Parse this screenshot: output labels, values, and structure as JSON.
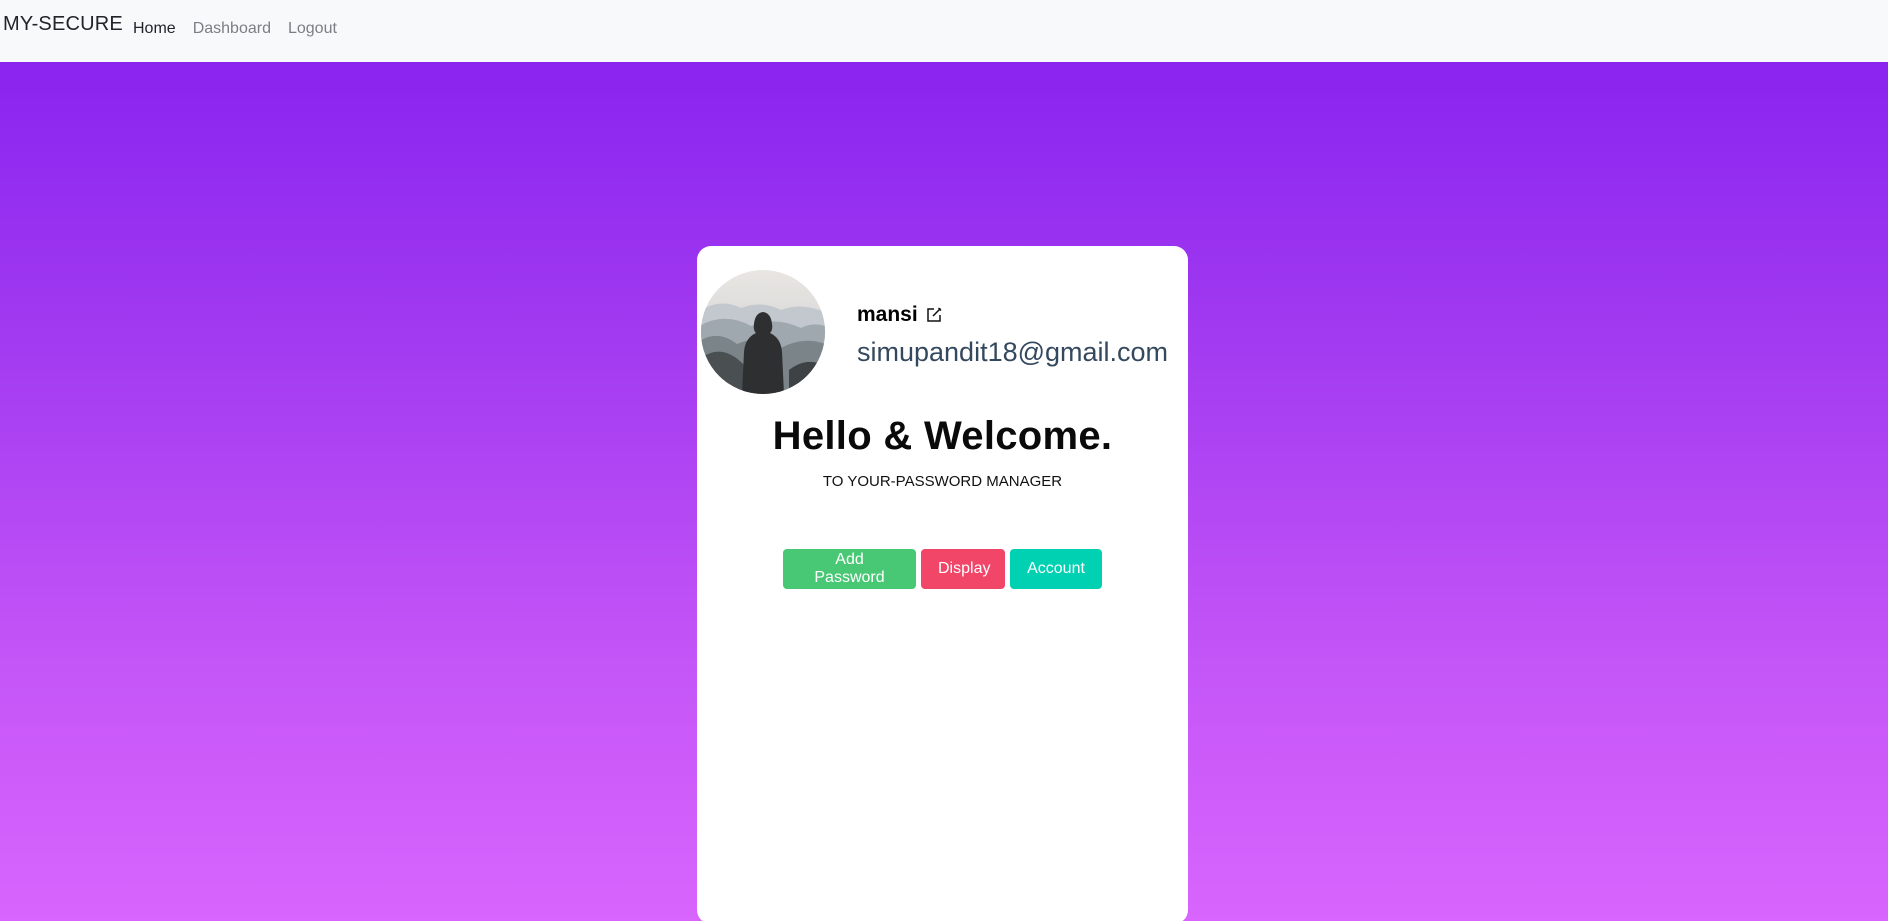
{
  "navbar": {
    "brand": "MY-SECURE",
    "links": [
      {
        "label": "Home",
        "active": true
      },
      {
        "label": "Dashboard",
        "active": false
      },
      {
        "label": "Logout",
        "active": false
      }
    ]
  },
  "profile": {
    "username": "mansi",
    "email": "simupandit18@gmail.com",
    "avatar_icon": "hooded-person-mountains-photo",
    "edit_icon": "edit-icon"
  },
  "welcome": {
    "heading": "Hello & Welcome.",
    "subtitle": "TO YOUR-PASSWORD MANAGER"
  },
  "actions": {
    "add_password": "Add Password",
    "display": "Display",
    "account": "Account"
  },
  "colors": {
    "gradient_top": "#8a24ef",
    "gradient_bottom": "#d865fd",
    "add_button": "#48c774",
    "display_button": "#f14668",
    "account_button": "#00d1b2",
    "email_text": "#34495e"
  }
}
